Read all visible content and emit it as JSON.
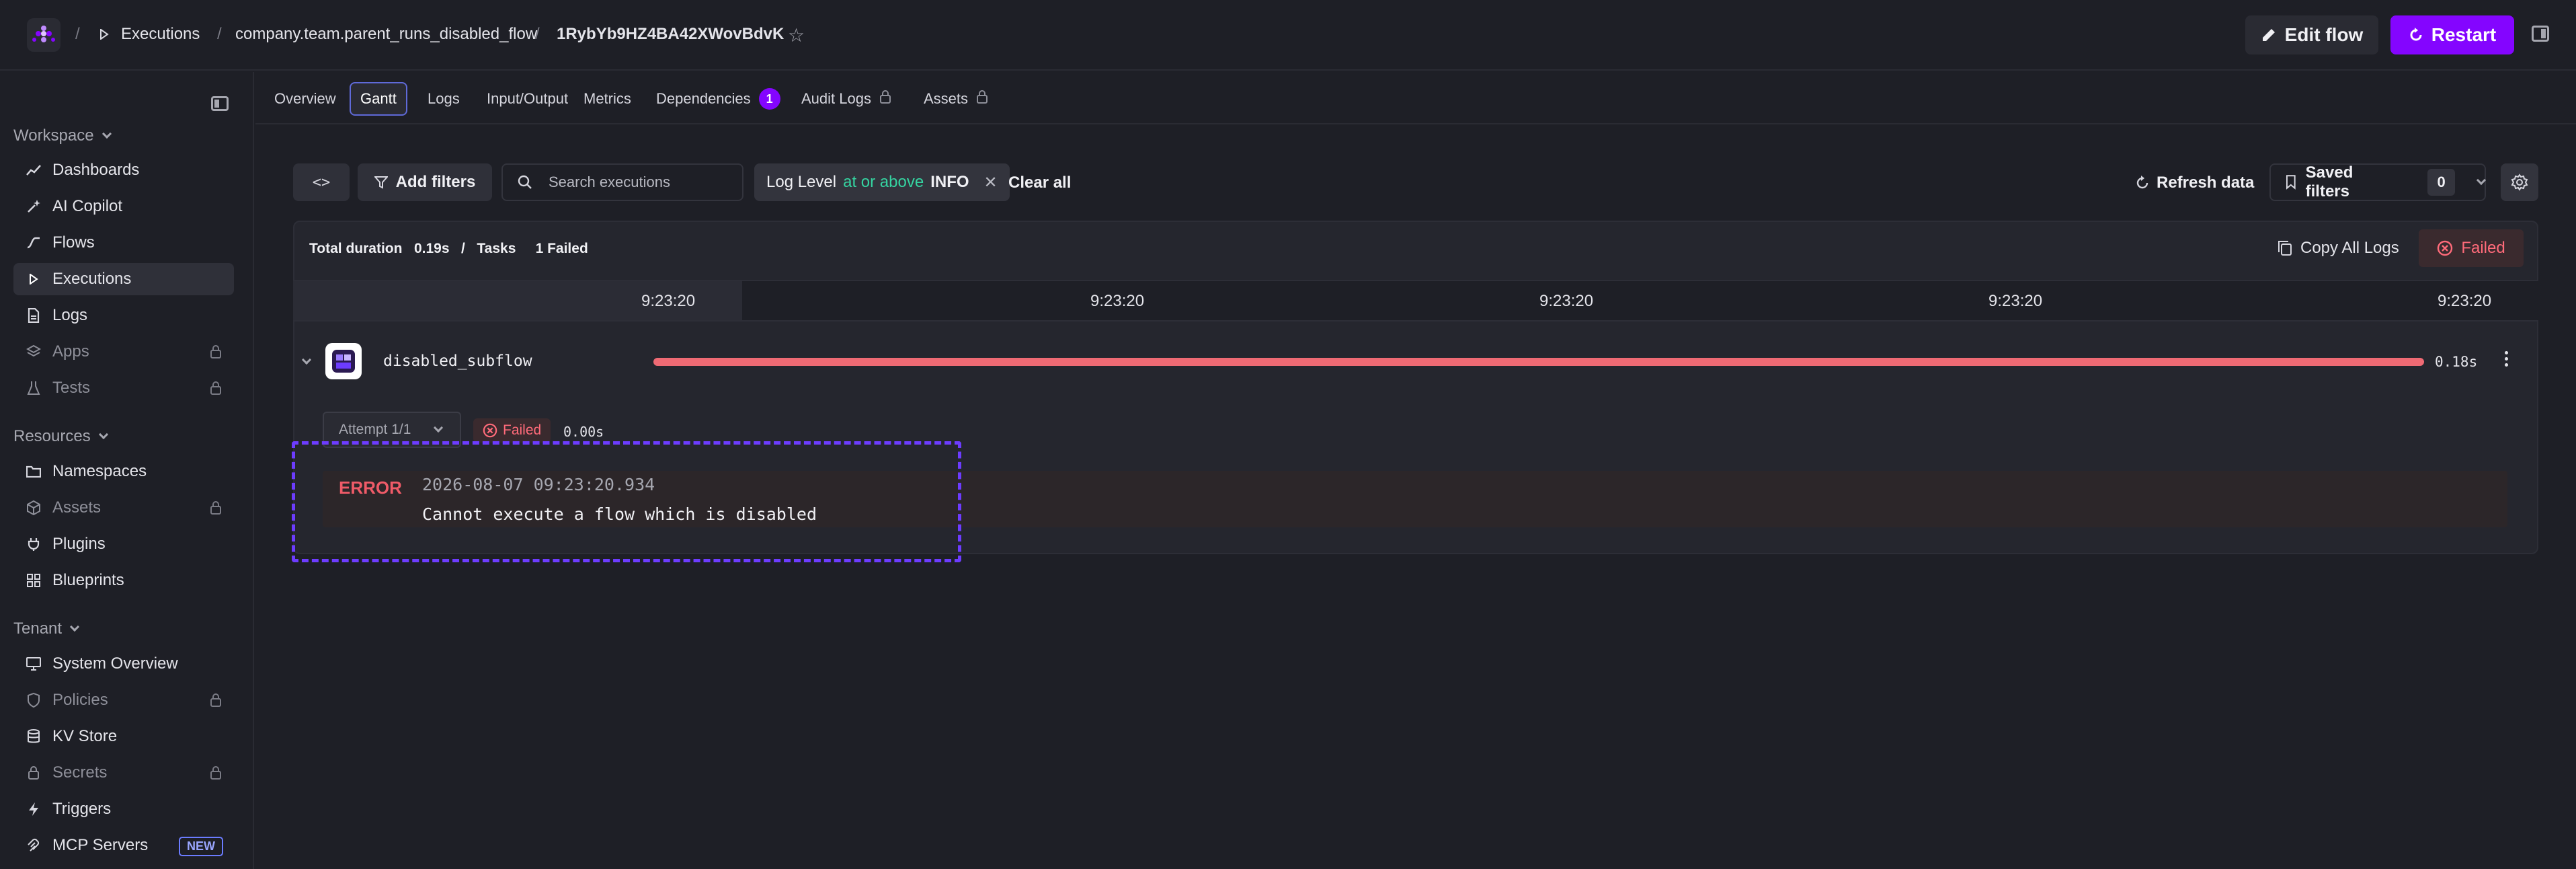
{
  "breadcrumb": {
    "executions": "Executions",
    "flow": "company.team.parent_runs_disabled_flow",
    "execution_id": "1RybYb9HZ4BA42XWovBdvK"
  },
  "header": {
    "edit_flow": "Edit flow",
    "restart": "Restart"
  },
  "sidebar": {
    "workspace": "Workspace",
    "workspace_items": [
      {
        "label": "Dashboards",
        "icon": "chart-line-icon",
        "locked": false
      },
      {
        "label": "AI Copilot",
        "icon": "sparkle-icon",
        "locked": false
      },
      {
        "label": "Flows",
        "icon": "flow-icon",
        "locked": false
      },
      {
        "label": "Executions",
        "icon": "play-icon",
        "locked": false,
        "active": true
      },
      {
        "label": "Logs",
        "icon": "file-icon",
        "locked": false
      },
      {
        "label": "Apps",
        "icon": "layers-icon",
        "locked": true
      },
      {
        "label": "Tests",
        "icon": "flask-icon",
        "locked": true
      }
    ],
    "resources": "Resources",
    "resources_items": [
      {
        "label": "Namespaces",
        "icon": "folder-icon",
        "locked": false
      },
      {
        "label": "Assets",
        "icon": "cube-icon",
        "locked": true
      },
      {
        "label": "Plugins",
        "icon": "plug-icon",
        "locked": false
      },
      {
        "label": "Blueprints",
        "icon": "grid-icon",
        "locked": false
      }
    ],
    "tenant": "Tenant",
    "tenant_items": [
      {
        "label": "System Overview",
        "icon": "monitor-icon",
        "locked": false
      },
      {
        "label": "Policies",
        "icon": "shield-icon",
        "locked": true
      },
      {
        "label": "KV Store",
        "icon": "database-icon",
        "locked": false
      },
      {
        "label": "Secrets",
        "icon": "lock-icon",
        "locked": true
      },
      {
        "label": "Triggers",
        "icon": "bolt-icon",
        "locked": false
      },
      {
        "label": "MCP Servers",
        "icon": "mcp-icon",
        "locked": false,
        "badge": "NEW"
      }
    ]
  },
  "tabs": {
    "overview": "Overview",
    "gantt": "Gantt",
    "logs": "Logs",
    "input_output": "Input/Output",
    "metrics": "Metrics",
    "dependencies": "Dependencies",
    "dependencies_count": "1",
    "audit_logs": "Audit Logs",
    "assets": "Assets"
  },
  "filters": {
    "add_filters": "Add filters",
    "search_placeholder": "Search executions",
    "log_level_label": "Log Level",
    "log_level_op": "at or above",
    "log_level_value": "INFO",
    "clear_all": "Clear all",
    "refresh": "Refresh data",
    "saved_filters": "Saved filters",
    "saved_count": "0"
  },
  "gantt": {
    "total_duration_label": "Total duration",
    "total_duration_value": "0.19s",
    "separator": "/",
    "tasks_label": "Tasks",
    "failed_summary": "1 Failed",
    "copy_all_logs": "Copy All Logs",
    "status_button": "Failed",
    "ticks": [
      "9:23:20",
      "9:23:20",
      "9:23:20",
      "9:23:20",
      "9:23:20"
    ],
    "task": {
      "name": "disabled_subflow",
      "duration": "0.18s",
      "progress_fraction": 1.0,
      "attempt": "Attempt 1/1",
      "status": "Failed",
      "attempt_duration": "0.00s"
    },
    "log": {
      "level": "ERROR",
      "timestamp": "2026-08-07 09:23:20.934",
      "message": "Cannot execute a flow which is disabled"
    }
  },
  "colors": {
    "accent": "#8405ff",
    "failed": "#ef6a74",
    "operator": "#35d4a1"
  }
}
